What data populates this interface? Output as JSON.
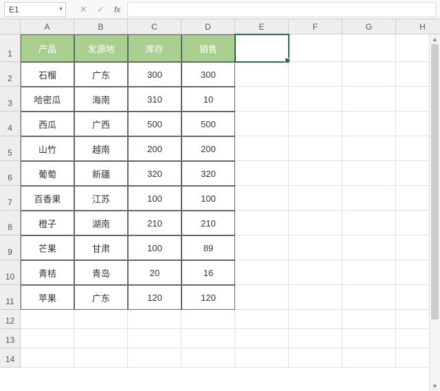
{
  "formula_bar": {
    "name_box": "E1",
    "cancel_icon": "✕",
    "confirm_icon": "✓",
    "fx_label": "fx",
    "formula_value": ""
  },
  "columns": [
    "A",
    "B",
    "C",
    "D",
    "E",
    "F",
    "G",
    "H"
  ],
  "rows": [
    "1",
    "2",
    "3",
    "4",
    "5",
    "6",
    "7",
    "8",
    "9",
    "10",
    "11",
    "12",
    "13",
    "14"
  ],
  "table": {
    "headers": [
      "产品",
      "发源地",
      "库存",
      "销售"
    ],
    "data": [
      [
        "石榴",
        "广东",
        "300",
        "300"
      ],
      [
        "哈密瓜",
        "海南",
        "310",
        "10"
      ],
      [
        "西瓜",
        "广西",
        "500",
        "500"
      ],
      [
        "山竹",
        "越南",
        "200",
        "200"
      ],
      [
        "葡萄",
        "新疆",
        "320",
        "320"
      ],
      [
        "百香果",
        "江苏",
        "100",
        "100"
      ],
      [
        "橙子",
        "湖南",
        "210",
        "210"
      ],
      [
        "芒果",
        "甘肃",
        "100",
        "89"
      ],
      [
        "青桔",
        "青岛",
        "20",
        "16"
      ],
      [
        "苹果",
        "广东",
        "120",
        "120"
      ]
    ]
  },
  "selected_cell": "E1"
}
